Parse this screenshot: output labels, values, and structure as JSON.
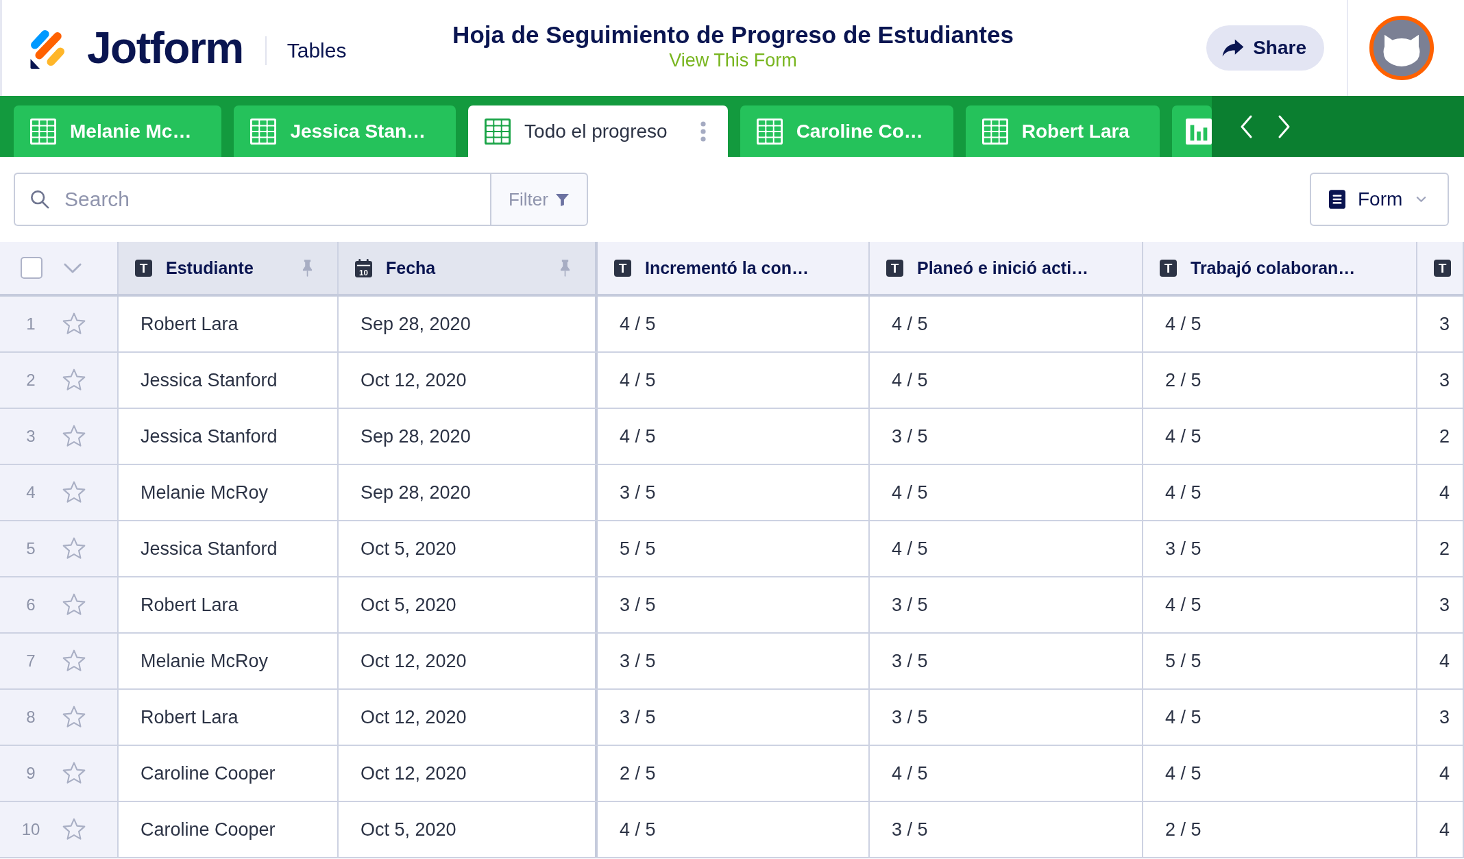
{
  "header": {
    "logo_text": "Jotform",
    "product": "Tables",
    "title": "Hoja de Seguimiento de Progreso de Estudiantes",
    "form_link": "View This Form",
    "share_button": "Share"
  },
  "tabs": [
    {
      "kind": "table",
      "label": "Melanie Mc…",
      "selected": false
    },
    {
      "kind": "table",
      "label": "Jessica Stan…",
      "selected": false
    },
    {
      "kind": "table",
      "label": "Todo el progreso",
      "selected": true
    },
    {
      "kind": "table",
      "label": "Caroline Co…",
      "selected": false
    },
    {
      "kind": "table",
      "label": "Robert Lara",
      "selected": false
    },
    {
      "kind": "report",
      "selected": false
    }
  ],
  "toolbar": {
    "search": {
      "placeholder": "Search"
    },
    "filter_button": "Filter",
    "view_button": "Form"
  },
  "table": {
    "select_all": {
      "checked": false
    },
    "columns": [
      {
        "kind": "text",
        "badge": "T",
        "label": "Estudiante",
        "pinned": true
      },
      {
        "kind": "date",
        "badge": "10",
        "label": "Fecha",
        "pinned": true
      },
      {
        "kind": "text",
        "badge": "T",
        "label": "Incrementó la con…",
        "pinned": false
      },
      {
        "kind": "text",
        "badge": "T",
        "label": "Planeó e inició acti…",
        "pinned": false
      },
      {
        "kind": "text",
        "badge": "T",
        "label": "Trabajó colaboran…",
        "pinned": false
      },
      {
        "kind": "text",
        "badge": "T",
        "pinned": false
      }
    ],
    "rows": [
      {
        "number": "1",
        "starred": false,
        "cells": [
          "Robert Lara",
          "Sep 28, 2020",
          "4 / 5",
          "4 / 5",
          "4 / 5",
          "3"
        ]
      },
      {
        "number": "2",
        "starred": false,
        "cells": [
          "Jessica Stanford",
          "Oct 12, 2020",
          "4 / 5",
          "4 / 5",
          "2 / 5",
          "3"
        ]
      },
      {
        "number": "3",
        "starred": false,
        "cells": [
          "Jessica Stanford",
          "Sep 28, 2020",
          "4 / 5",
          "3 / 5",
          "4 / 5",
          "2"
        ]
      },
      {
        "number": "4",
        "starred": false,
        "cells": [
          "Melanie McRoy",
          "Sep 28, 2020",
          "3 / 5",
          "4 / 5",
          "4 / 5",
          "4"
        ]
      },
      {
        "number": "5",
        "starred": false,
        "cells": [
          "Jessica Stanford",
          "Oct 5, 2020",
          "5 / 5",
          "4 / 5",
          "3 / 5",
          "2"
        ]
      },
      {
        "number": "6",
        "starred": false,
        "cells": [
          "Robert Lara",
          "Oct 5, 2020",
          "3 / 5",
          "3 / 5",
          "4 / 5",
          "3"
        ]
      },
      {
        "number": "7",
        "starred": false,
        "cells": [
          "Melanie McRoy",
          "Oct 12, 2020",
          "3 / 5",
          "3 / 5",
          "5 / 5",
          "4"
        ]
      },
      {
        "number": "8",
        "starred": false,
        "cells": [
          "Robert Lara",
          "Oct 12, 2020",
          "3 / 5",
          "3 / 5",
          "4 / 5",
          "3"
        ]
      },
      {
        "number": "9",
        "starred": false,
        "cells": [
          "Caroline Cooper",
          "Oct 12, 2020",
          "2 / 5",
          "4 / 5",
          "4 / 5",
          "4"
        ]
      },
      {
        "number": "10",
        "starred": false,
        "cells": [
          "Caroline Cooper",
          "Oct 5, 2020",
          "4 / 5",
          "3 / 5",
          "2 / 5",
          "4"
        ]
      }
    ]
  }
}
